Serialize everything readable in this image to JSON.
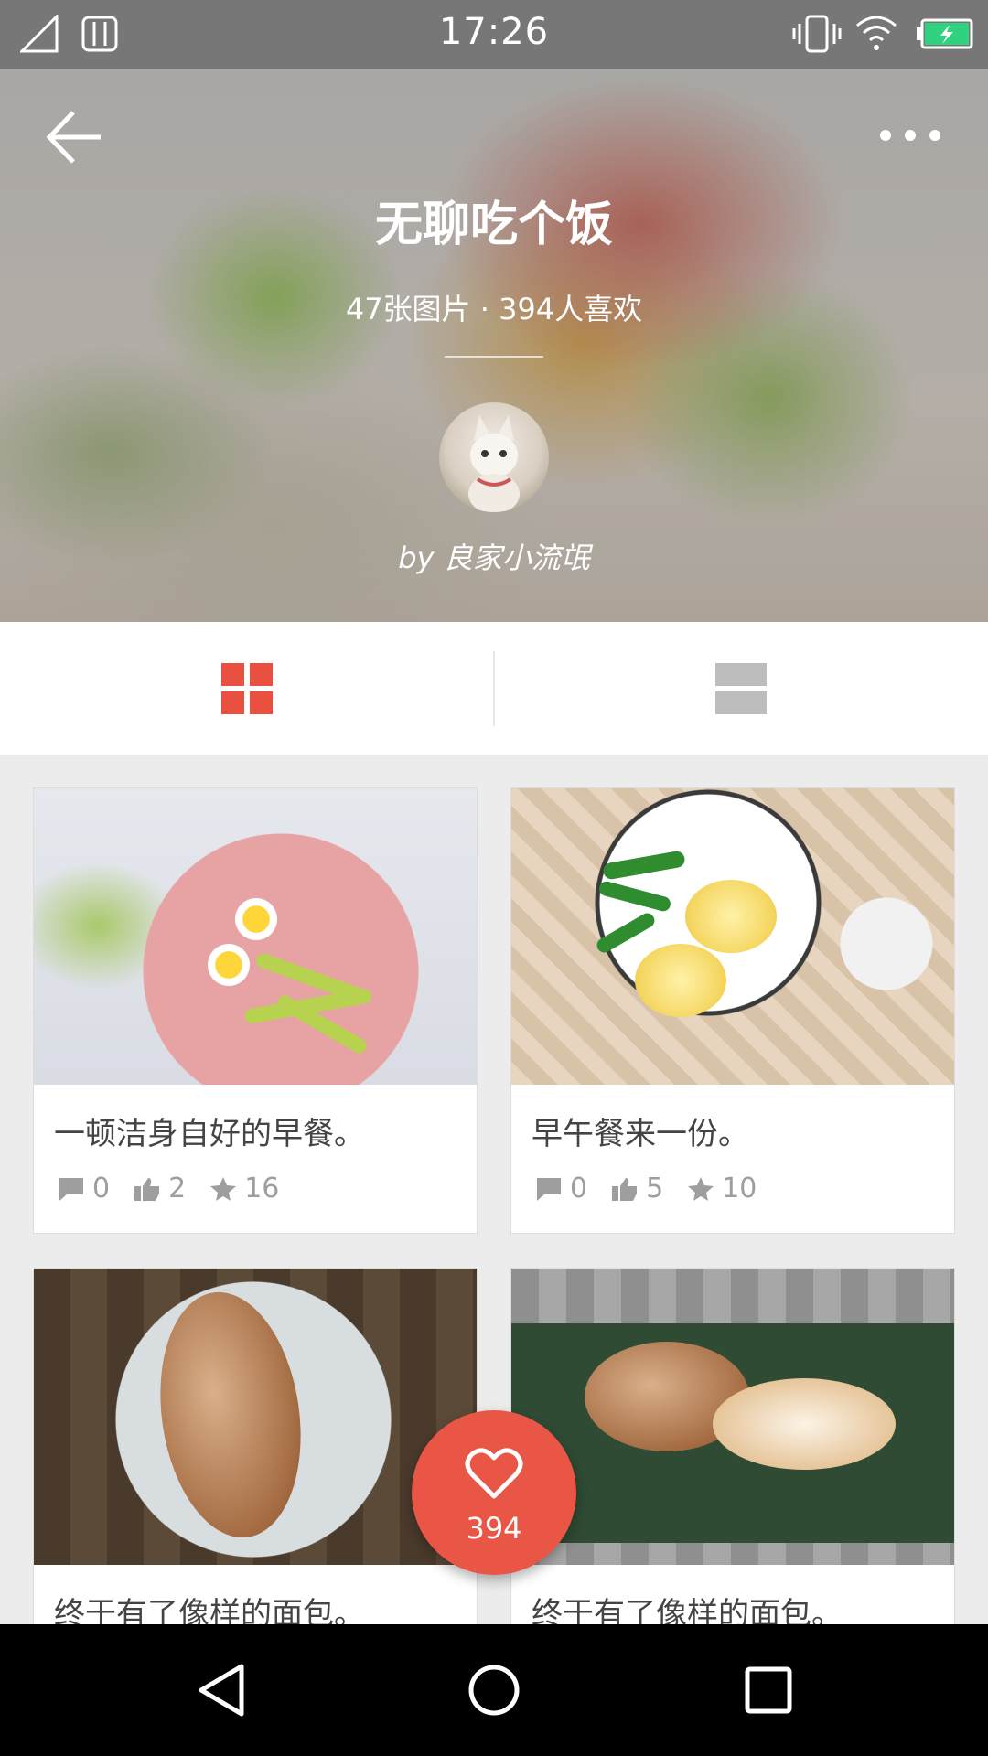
{
  "status_bar": {
    "time": "17:26",
    "icons": [
      "signal-icon",
      "sim-icon",
      "vibrate-icon",
      "wifi-icon",
      "battery-charging-icon"
    ],
    "battery_color": "#2fd27f"
  },
  "header": {
    "title": "无聊吃个饭",
    "stats": "47张图片 · 394人喜欢",
    "author": "by 良家小流氓",
    "icons": [
      "back-arrow-icon",
      "more-dots-icon"
    ]
  },
  "view_tabs": {
    "active_color": "#e9503f",
    "inactive_color": "#bdbdbd",
    "items": [
      {
        "name": "grid-view",
        "icon": "grid-icon",
        "active": true
      },
      {
        "name": "list-view",
        "icon": "list-icon",
        "active": false
      }
    ]
  },
  "cards": [
    {
      "title": "一顿洁身自好的早餐。",
      "comments": "0",
      "likes": "2",
      "stars": "16"
    },
    {
      "title": "早午餐来一份。",
      "comments": "0",
      "likes": "5",
      "stars": "10"
    },
    {
      "title": "终于有了像样的面包。",
      "comments": "",
      "likes": "",
      "stars": ""
    },
    {
      "title": "终于有了像样的面包。",
      "comments": "",
      "likes": "",
      "stars": ""
    }
  ],
  "fab": {
    "icon": "heart-icon",
    "count": "394",
    "color": "#e95646"
  },
  "navbar": {
    "icons": [
      "nav-back-icon",
      "nav-home-icon",
      "nav-recents-icon"
    ]
  }
}
